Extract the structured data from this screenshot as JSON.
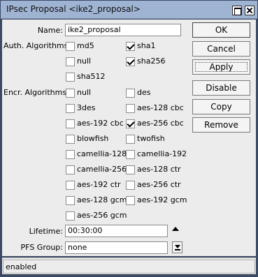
{
  "window": {
    "title": "IPsec Proposal <ike2_proposal>"
  },
  "form": {
    "name_label": "Name:",
    "name_value": "ike2_proposal",
    "auth_label": "Auth. Algorithms:",
    "auth": [
      {
        "label": "md5",
        "checked": false
      },
      {
        "label": "sha1",
        "checked": true
      },
      {
        "label": "null",
        "checked": false
      },
      {
        "label": "sha256",
        "checked": true
      },
      {
        "label": "sha512",
        "checked": false
      }
    ],
    "encr_label": "Encr. Algorithms:",
    "encr": [
      {
        "label": "null",
        "checked": false
      },
      {
        "label": "des",
        "checked": false
      },
      {
        "label": "3des",
        "checked": false
      },
      {
        "label": "aes-128 cbc",
        "checked": false
      },
      {
        "label": "aes-192 cbc",
        "checked": false
      },
      {
        "label": "aes-256 cbc",
        "checked": true
      },
      {
        "label": "blowfish",
        "checked": false
      },
      {
        "label": "twofish",
        "checked": false
      },
      {
        "label": "camellia-128",
        "checked": false
      },
      {
        "label": "camellia-192",
        "checked": false
      },
      {
        "label": "camellia-256",
        "checked": false
      },
      {
        "label": "aes-128 ctr",
        "checked": false
      },
      {
        "label": "aes-192 ctr",
        "checked": false
      },
      {
        "label": "aes-256 ctr",
        "checked": false
      },
      {
        "label": "aes-128 gcm",
        "checked": false
      },
      {
        "label": "aes-192 gcm",
        "checked": false
      },
      {
        "label": "aes-256 gcm",
        "checked": false
      }
    ],
    "lifetime_label": "Lifetime:",
    "lifetime_value": "00:30:00",
    "pfs_label": "PFS Group:",
    "pfs_value": "none"
  },
  "buttons": {
    "ok": "OK",
    "cancel": "Cancel",
    "apply": "Apply",
    "disable": "Disable",
    "copy": "Copy",
    "remove": "Remove"
  },
  "status": {
    "text": "enabled"
  }
}
